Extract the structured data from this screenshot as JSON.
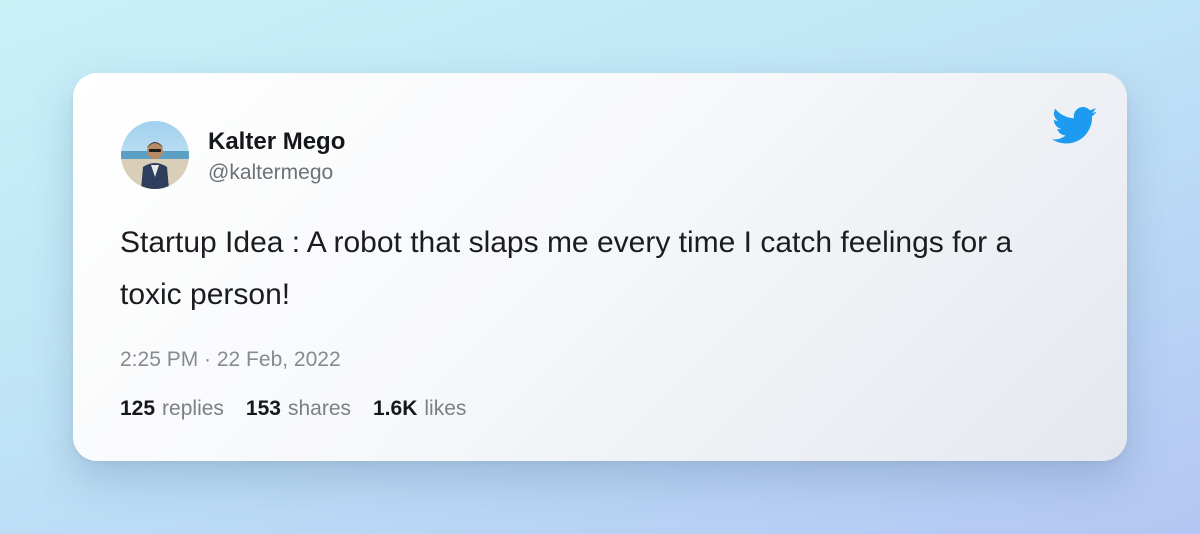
{
  "tweet": {
    "author": {
      "name": "Kalter Mego",
      "handle": "@kaltermego",
      "avatar": "avatar-photo"
    },
    "brand_icon": "twitter-bird-icon",
    "brand_color": "#1d9bf0",
    "text": "Startup Idea : A robot that slaps me every time I catch feelings for a toxic person!",
    "timestamp": "2:25 PM · 22 Feb, 2022",
    "stats": [
      {
        "count": "125",
        "label": "replies"
      },
      {
        "count": "153",
        "label": "shares"
      },
      {
        "count": "1.6K",
        "label": "likes"
      }
    ]
  }
}
